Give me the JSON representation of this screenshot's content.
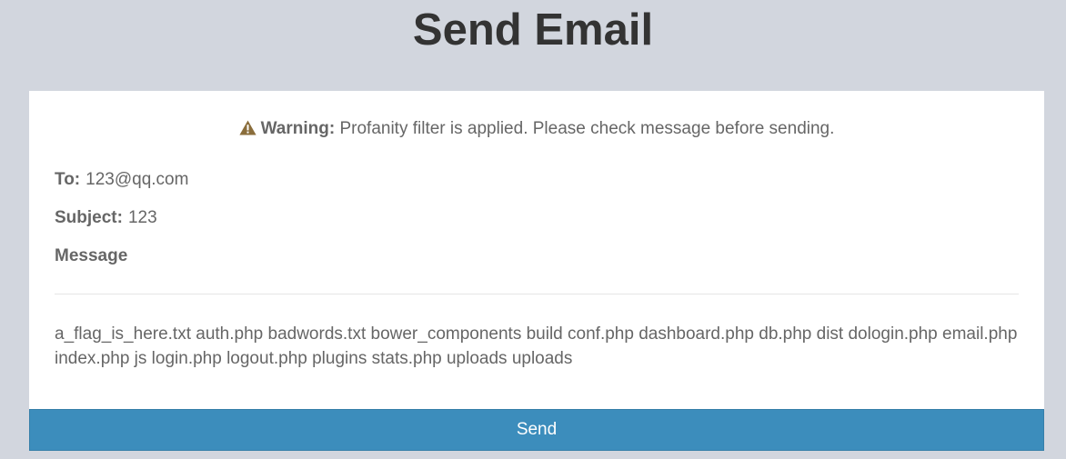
{
  "page": {
    "title": "Send Email"
  },
  "warning": {
    "icon": "warning-icon",
    "label": "Warning:",
    "text": "Profanity filter is applied. Please check message before sending."
  },
  "email": {
    "to_label": "To:",
    "to_value": "123@qq.com",
    "subject_label": "Subject:",
    "subject_value": "123",
    "message_label": "Message",
    "message_body": "a_flag_is_here.txt auth.php badwords.txt bower_components build conf.php dashboard.php db.php dist dologin.php email.php index.php js login.php logout.php plugins stats.php uploads uploads"
  },
  "actions": {
    "send_label": "Send"
  },
  "colors": {
    "background": "#d2d6de",
    "primary_button": "#3c8dbc",
    "warning_icon": "#8a6d3b"
  }
}
